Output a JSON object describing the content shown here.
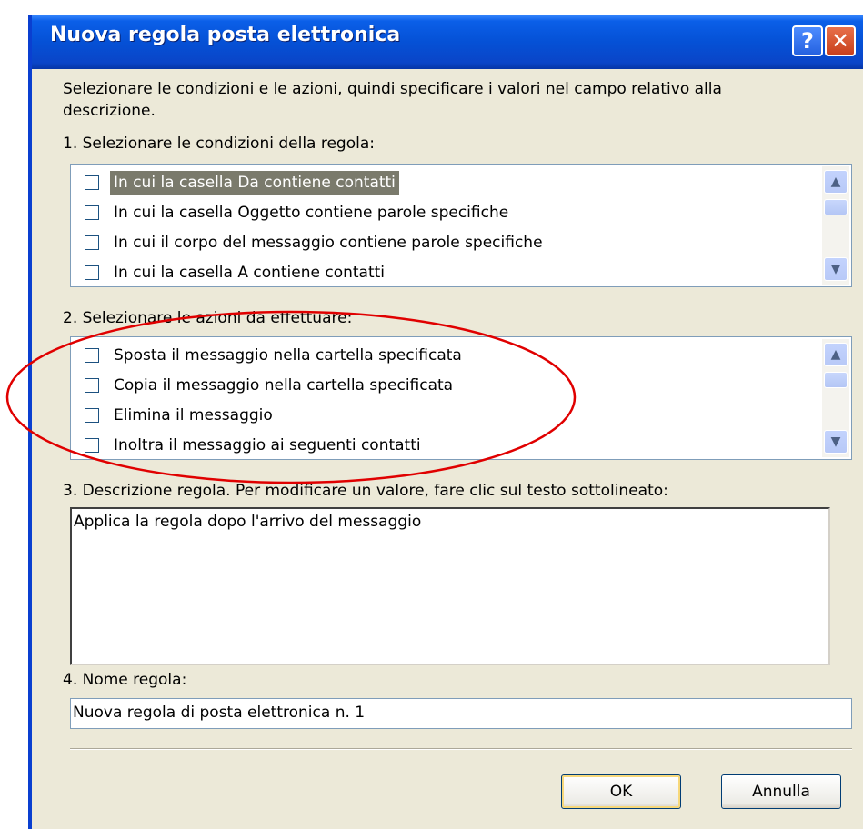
{
  "background_caption": "",
  "window": {
    "title": "Nuova regola posta elettronica",
    "help_glyph": "?",
    "close_glyph": "✕"
  },
  "intro": "Selezionare le condizioni e le azioni, quindi specificare i valori nel campo relativo alla",
  "intro_line2": "descrizione.",
  "conditions": {
    "label": "1. Selezionare le condizioni della regola:",
    "items": [
      {
        "label": "In cui la casella Da contiene contatti",
        "checked": false,
        "selected": true
      },
      {
        "label": "In cui la casella Oggetto contiene parole specifiche",
        "checked": false
      },
      {
        "label": "In cui il corpo del messaggio contiene parole specifiche",
        "checked": false
      },
      {
        "label": "In cui la casella A contiene contatti",
        "checked": false
      }
    ]
  },
  "actions": {
    "label": "2. Selezionare le azioni da effettuare:",
    "items": [
      {
        "label": "Sposta il messaggio nella cartella specificata",
        "checked": false
      },
      {
        "label": "Copia il messaggio nella cartella specificata",
        "checked": false
      },
      {
        "label": "Elimina il messaggio",
        "checked": false
      },
      {
        "label": "Inoltra il messaggio ai seguenti contatti",
        "checked": false
      }
    ]
  },
  "description": {
    "label": "3. Descrizione regola. Per modificare un valore, fare clic sul testo sottolineato:",
    "text": "Applica la regola dopo l'arrivo del messaggio"
  },
  "name": {
    "label": "4. Nome regola:",
    "value": "Nuova regola di posta elettronica n. 1"
  },
  "buttons": {
    "ok": "OK",
    "cancel": "Annulla"
  },
  "colors": {
    "titlebar": "#0551d6",
    "dialog_bg": "#ece9d8",
    "annotation": "#e00000",
    "selection": "#7a7a6c"
  },
  "icons": {
    "scroll_up": "▲",
    "scroll_down": "▼"
  }
}
